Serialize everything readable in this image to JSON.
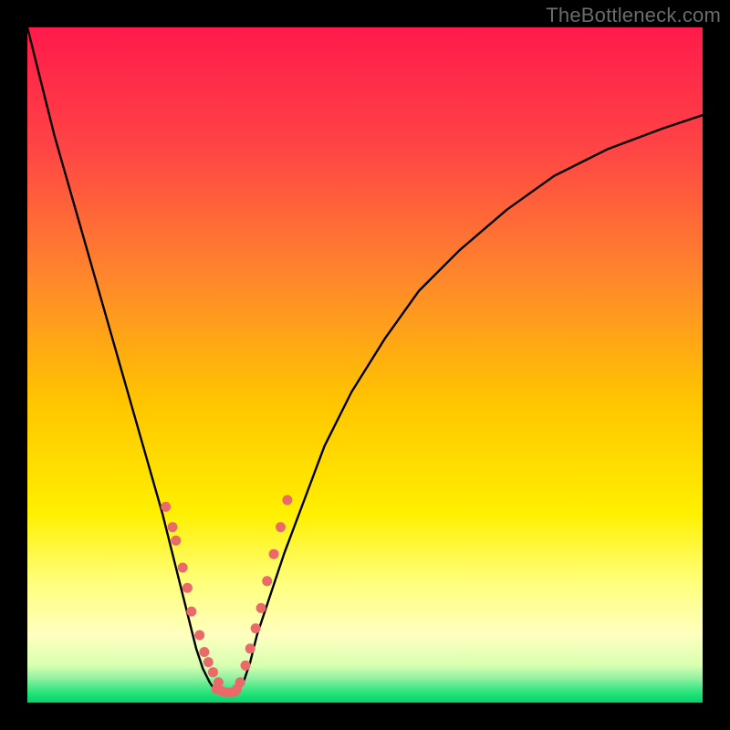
{
  "watermark": "TheBottleneck.com",
  "chart_data": {
    "type": "line",
    "title": "",
    "xlabel": "",
    "ylabel": "",
    "xlim": [
      0,
      100
    ],
    "ylim": [
      0,
      100
    ],
    "grid": false,
    "legend": false,
    "background_gradient_stops": [
      {
        "pos": 0.0,
        "color": "#ff1a4b"
      },
      {
        "pos": 0.18,
        "color": "#ff4545"
      },
      {
        "pos": 0.38,
        "color": "#ff8a2a"
      },
      {
        "pos": 0.55,
        "color": "#ffc400"
      },
      {
        "pos": 0.72,
        "color": "#fff000"
      },
      {
        "pos": 0.82,
        "color": "#ffff7a"
      },
      {
        "pos": 0.9,
        "color": "#ffffc0"
      },
      {
        "pos": 0.945,
        "color": "#d8ffb0"
      },
      {
        "pos": 0.965,
        "color": "#8cf0a0"
      },
      {
        "pos": 0.985,
        "color": "#28e47a"
      },
      {
        "pos": 1.0,
        "color": "#00d46a"
      }
    ],
    "series": [
      {
        "name": "left-branch",
        "type": "line",
        "color": "#000000",
        "stroke_width": 2.4,
        "x": [
          0,
          2,
          4,
          6,
          8,
          10,
          12,
          14,
          16,
          18,
          20,
          22,
          23,
          24,
          25,
          26,
          27,
          28
        ],
        "y": [
          100,
          92,
          84,
          77,
          70,
          63,
          56,
          49,
          42,
          35,
          28,
          20,
          16,
          12,
          8,
          5,
          3,
          1.5
        ]
      },
      {
        "name": "right-branch",
        "type": "line",
        "color": "#000000",
        "stroke_width": 2.4,
        "x": [
          31,
          32,
          33,
          34,
          36,
          38,
          41,
          44,
          48,
          53,
          58,
          64,
          71,
          78,
          86,
          94,
          100
        ],
        "y": [
          1.5,
          3,
          6,
          10,
          16,
          22,
          30,
          38,
          46,
          54,
          61,
          67,
          73,
          78,
          82,
          85,
          87
        ]
      },
      {
        "name": "valley-floor",
        "type": "line",
        "color": "#000000",
        "stroke_width": 2.4,
        "x": [
          28,
          29,
          30,
          31
        ],
        "y": [
          1.5,
          1.2,
          1.2,
          1.5
        ]
      },
      {
        "name": "left-dots",
        "type": "scatter",
        "color": "#ea6a6a",
        "marker_size": 11,
        "x": [
          20.5,
          21.5,
          22.0,
          23.0,
          23.7,
          24.3,
          25.5,
          26.2,
          26.8,
          27.5,
          28.3
        ],
        "y": [
          29.0,
          26.0,
          24.0,
          20.0,
          17.0,
          13.5,
          10.0,
          7.5,
          6.0,
          4.5,
          3.0
        ]
      },
      {
        "name": "right-dots",
        "type": "scatter",
        "color": "#ea6a6a",
        "marker_size": 11,
        "x": [
          31.5,
          32.3,
          33.0,
          33.8,
          34.6,
          35.5,
          36.5,
          37.5,
          38.5
        ],
        "y": [
          3.0,
          5.5,
          8.0,
          11.0,
          14.0,
          18.0,
          22.0,
          26.0,
          30.0
        ]
      },
      {
        "name": "floor-dots",
        "type": "scatter",
        "color": "#ea6a6a",
        "marker_size": 11,
        "x": [
          28.0,
          28.8,
          29.5,
          30.2,
          30.8,
          31.0
        ],
        "y": [
          2.0,
          1.7,
          1.5,
          1.5,
          1.7,
          2.0
        ]
      }
    ]
  }
}
